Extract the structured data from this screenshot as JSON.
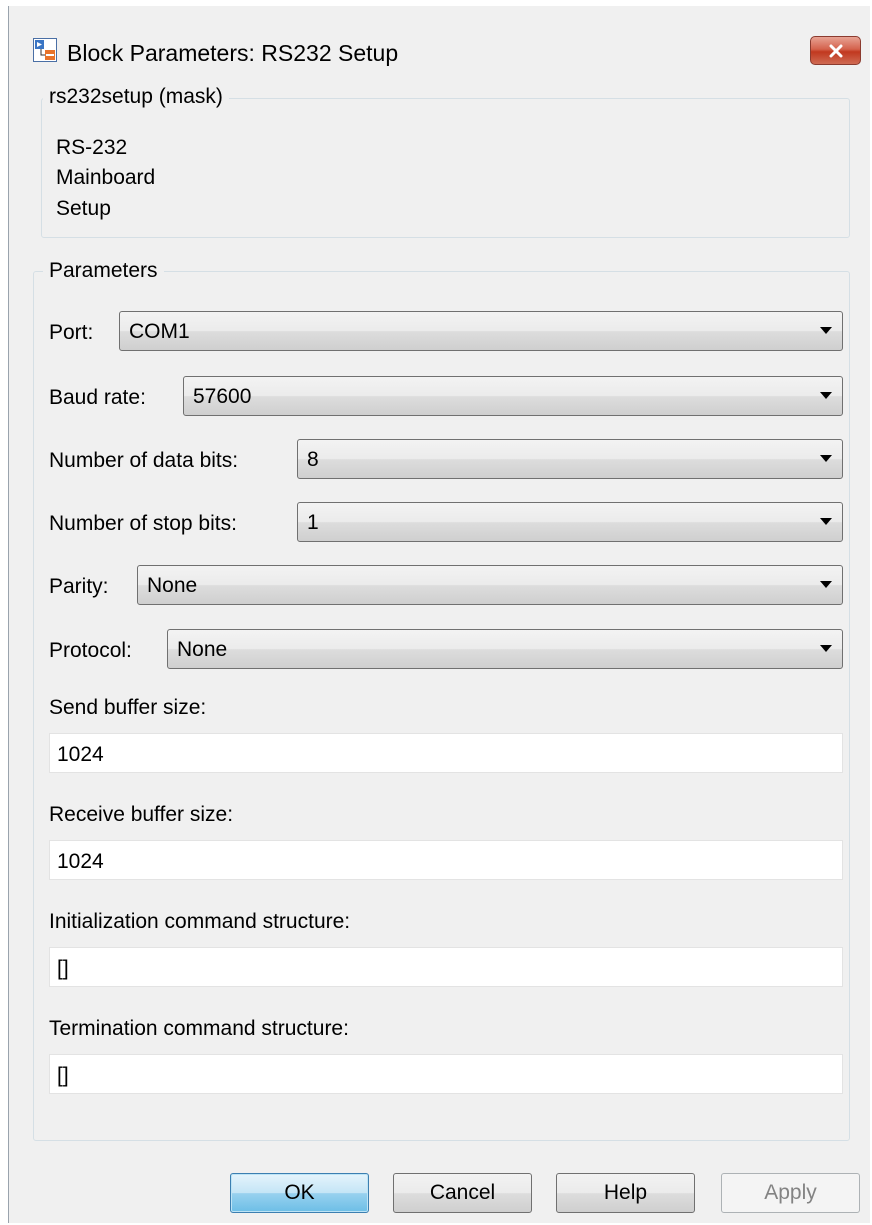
{
  "window": {
    "title": "Block Parameters: RS232 Setup",
    "close_icon": "close-icon"
  },
  "mask": {
    "legend": "rs232setup (mask)",
    "description_lines": [
      "RS-232",
      "Mainboard",
      "Setup"
    ]
  },
  "parameters": {
    "legend": "Parameters",
    "port": {
      "label": "Port:",
      "value": "COM1"
    },
    "baud_rate": {
      "label": "Baud rate:",
      "value": "57600"
    },
    "data_bits": {
      "label": "Number of data bits:",
      "value": "8"
    },
    "stop_bits": {
      "label": "Number of stop bits:",
      "value": "1"
    },
    "parity": {
      "label": "Parity:",
      "value": "None"
    },
    "protocol": {
      "label": "Protocol:",
      "value": "None"
    },
    "send_buffer": {
      "label": "Send buffer size:",
      "value": "1024"
    },
    "receive_buffer": {
      "label": "Receive buffer size:",
      "value": "1024"
    },
    "init_command": {
      "label": "Initialization command structure:",
      "value": "[]"
    },
    "term_command": {
      "label": "Termination command structure:",
      "value": "[]"
    }
  },
  "buttons": {
    "ok": "OK",
    "cancel": "Cancel",
    "help": "Help",
    "apply": "Apply"
  },
  "colors": {
    "dialog_background": "#f0f0f0",
    "default_button_accent": "#98d1ef",
    "close_button_accent": "#c1381f"
  }
}
